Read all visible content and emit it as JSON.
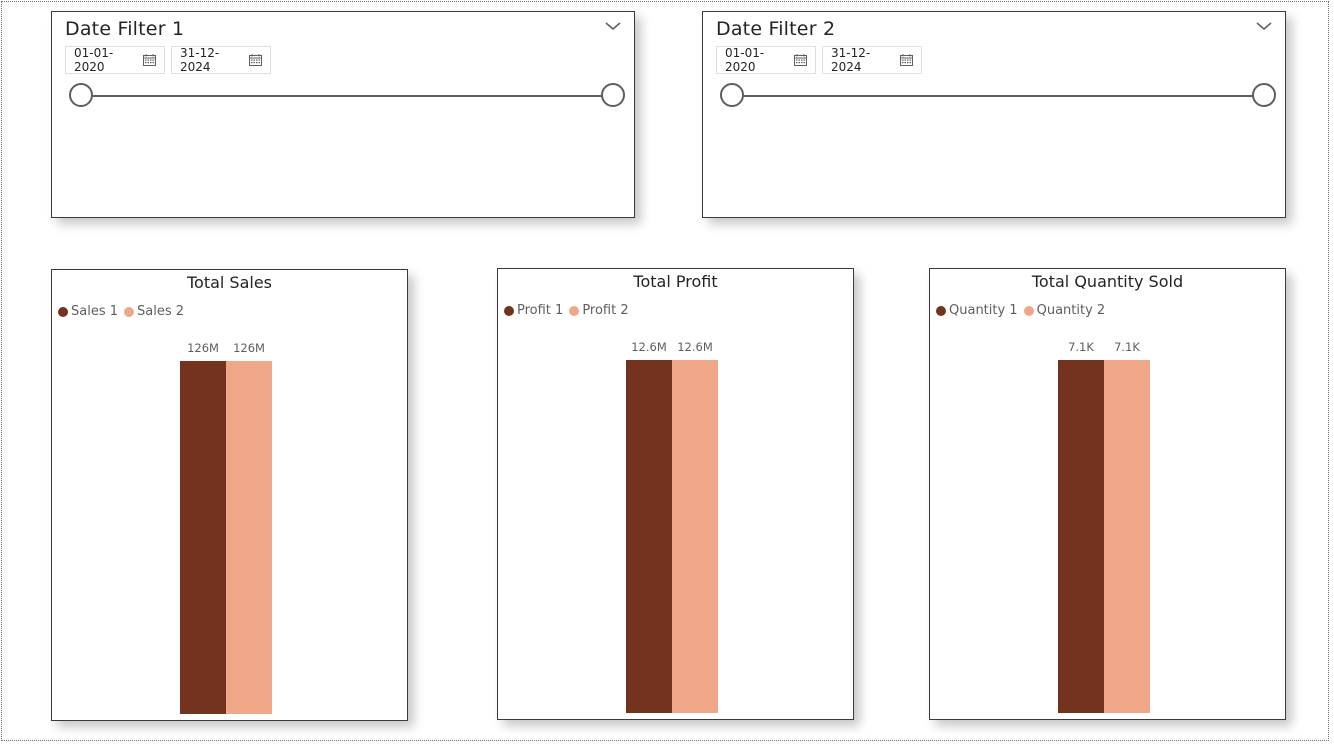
{
  "colors": {
    "series1": "#73331e",
    "series2": "#f0a787"
  },
  "slicers": [
    {
      "title": "Date Filter 1",
      "start_date": "01-01-2020",
      "end_date": "31-12-2024",
      "icon": "calendar-icon",
      "range_position": [
        0,
        1
      ]
    },
    {
      "title": "Date Filter 2",
      "start_date": "01-01-2020",
      "end_date": "31-12-2024",
      "icon": "calendar-icon",
      "range_position": [
        0,
        1
      ]
    }
  ],
  "chart_data": [
    {
      "type": "bar",
      "title": "Total Sales",
      "legend": "top-left",
      "series": [
        {
          "name": "Sales 1",
          "values": [
            126000000
          ],
          "label": "126M"
        },
        {
          "name": "Sales 2",
          "values": [
            126000000
          ],
          "label": "126M"
        }
      ],
      "ylim": [
        0,
        126000000
      ]
    },
    {
      "type": "bar",
      "title": "Total Profit",
      "legend": "top-left",
      "series": [
        {
          "name": "Profit 1",
          "values": [
            12600000
          ],
          "label": "12.6M"
        },
        {
          "name": "Profit 2",
          "values": [
            12600000
          ],
          "label": "12.6M"
        }
      ],
      "ylim": [
        0,
        12600000
      ]
    },
    {
      "type": "bar",
      "title": "Total Quantity Sold",
      "legend": "top-left",
      "series": [
        {
          "name": "Quantity 1",
          "values": [
            7100
          ],
          "label": "7.1K"
        },
        {
          "name": "Quantity 2",
          "values": [
            7100
          ],
          "label": "7.1K"
        }
      ],
      "ylim": [
        0,
        7100
      ]
    }
  ]
}
